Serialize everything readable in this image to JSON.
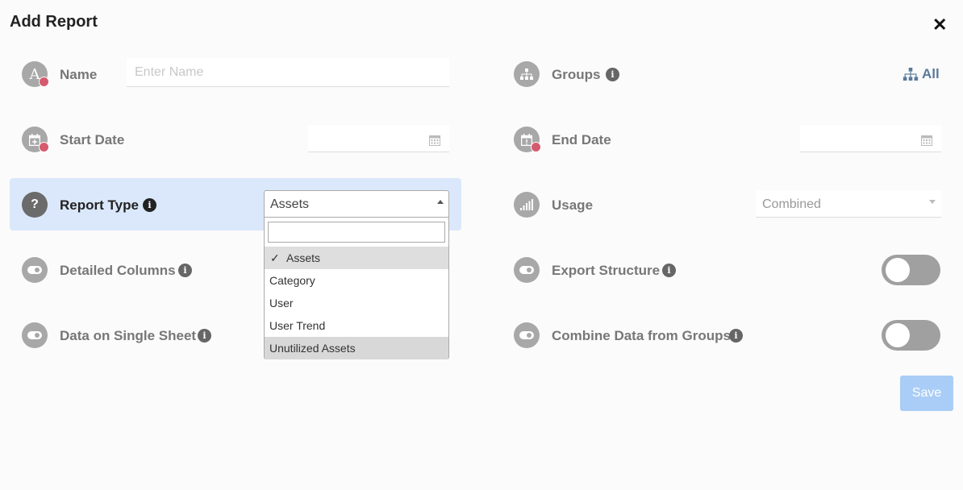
{
  "dialog": {
    "title": "Add Report",
    "close_label": "✕"
  },
  "fields": {
    "name": {
      "label": "Name",
      "placeholder": "Enter Name",
      "value": ""
    },
    "groups": {
      "label": "Groups",
      "value": "All"
    },
    "start_date": {
      "label": "Start Date",
      "value": ""
    },
    "end_date": {
      "label": "End Date",
      "value": ""
    },
    "report_type": {
      "label": "Report Type",
      "selected": "Assets",
      "search_value": "",
      "options": [
        "Assets",
        "Category",
        "User",
        "User Trend",
        "Unutilized Assets"
      ],
      "hovered_option": "Unutilized Assets"
    },
    "usage": {
      "label": "Usage",
      "selected": "Combined"
    },
    "detailed_columns": {
      "label": "Detailed Columns"
    },
    "export_structure": {
      "label": "Export Structure",
      "on": false
    },
    "data_single_sheet": {
      "label": "Data on Single Sheet"
    },
    "combine_groups": {
      "label": "Combine Data from Groups",
      "on": false
    }
  },
  "buttons": {
    "save": "Save"
  },
  "icons": {
    "info": "i",
    "name": "A",
    "report_type": "?",
    "check": "✓"
  },
  "colors": {
    "required_dot": "#d65a6f",
    "highlight_bg": "#dbe8fb",
    "save_bg": "#a9cdf6",
    "link": "#5a7a99"
  }
}
